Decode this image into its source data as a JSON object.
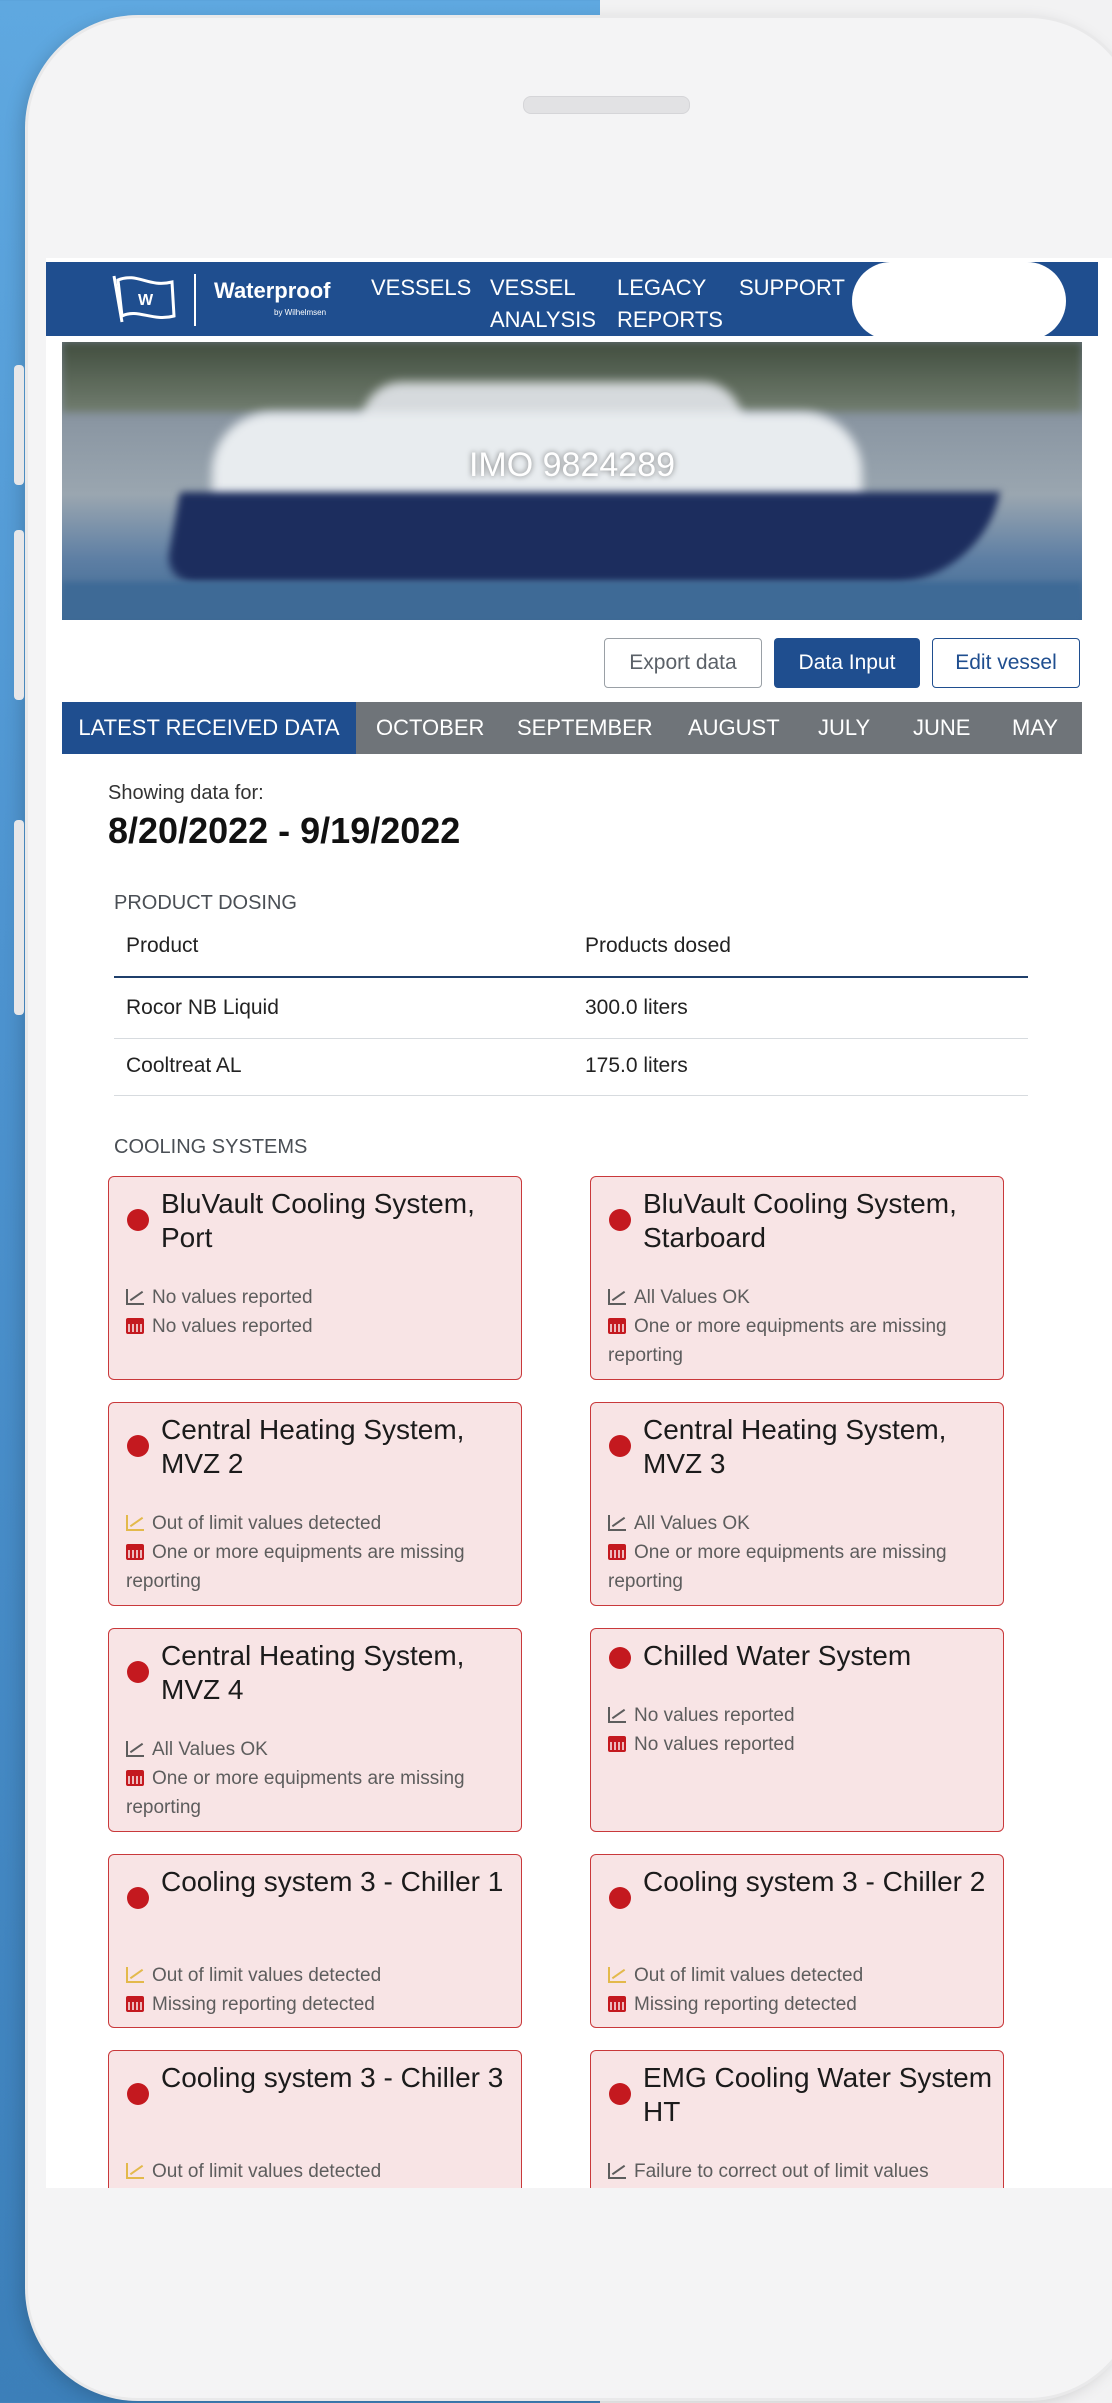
{
  "nav": {
    "brand": "Waterproof",
    "brand_sub": "by Wilhelmsen",
    "items": [
      {
        "label": "VESSELS"
      },
      {
        "label": "VESSEL\nANALYSIS"
      },
      {
        "label": "LEGACY\nREPORTS"
      },
      {
        "label": "SUPPORT"
      }
    ]
  },
  "hero": {
    "title": "IMO 9824289"
  },
  "actions": {
    "export": "Export data",
    "data_input": "Data Input",
    "edit": "Edit vessel"
  },
  "tabs": [
    {
      "label": "LATEST RECEIVED DATA",
      "active": true
    },
    {
      "label": "OCTOBER"
    },
    {
      "label": "SEPTEMBER"
    },
    {
      "label": "AUGUST"
    },
    {
      "label": "JULY"
    },
    {
      "label": "JUNE"
    },
    {
      "label": "MAY"
    }
  ],
  "period": {
    "label": "Showing data for:",
    "range": "8/20/2022 - 9/19/2022"
  },
  "product_dosing": {
    "title": "PRODUCT DOSING",
    "headers": [
      "Product",
      "Products dosed"
    ],
    "rows": [
      [
        "Rocor NB Liquid",
        "300.0 liters"
      ],
      [
        "Cooltreat AL",
        "175.0 liters"
      ]
    ]
  },
  "cooling": {
    "title": "COOLING SYSTEMS",
    "cards": [
      {
        "title": "BluVault Cooling System, Port",
        "values": "No values reported",
        "values_status": "neutral",
        "reporting": "No values reported"
      },
      {
        "title": "BluVault Cooling System, Starboard",
        "values": "All Values OK",
        "values_status": "neutral",
        "reporting": "One or more equipments are missing reporting"
      },
      {
        "title": "Central Heating System, MVZ 2",
        "values": "Out of limit values detected",
        "values_status": "warning",
        "reporting": "One or more equipments are missing reporting"
      },
      {
        "title": "Central Heating System, MVZ 3",
        "values": "All Values OK",
        "values_status": "neutral",
        "reporting": "One or more equipments are missing reporting"
      },
      {
        "title": "Central Heating System, MVZ 4",
        "values": "All Values OK",
        "values_status": "neutral",
        "reporting": "One or more equipments are missing reporting"
      },
      {
        "title": "Chilled Water System",
        "values": "No values reported",
        "values_status": "neutral",
        "reporting": "No values reported"
      },
      {
        "title": "Cooling system 3 - Chiller 1",
        "values": "Out of limit values detected",
        "values_status": "warning",
        "reporting": "Missing reporting detected"
      },
      {
        "title": "Cooling system 3 - Chiller 2",
        "values": "Out of limit values detected",
        "values_status": "warning",
        "reporting": "Missing reporting detected"
      },
      {
        "title": "Cooling system 3 - Chiller 3",
        "values": "Out of limit values detected",
        "values_status": "warning",
        "reporting": ""
      },
      {
        "title": "EMG Cooling Water System HT",
        "values": "Failure to correct out of limit values",
        "values_status": "neutral",
        "reporting": ""
      }
    ]
  },
  "colors": {
    "primary": "#1f4e8f",
    "tab_bar": "#6f7479",
    "card_bg": "#f8e4e5",
    "card_border": "#c9393b",
    "status_dot": "#c4191f",
    "warning": "#e3b94b",
    "chat": "#2a8cd8"
  }
}
